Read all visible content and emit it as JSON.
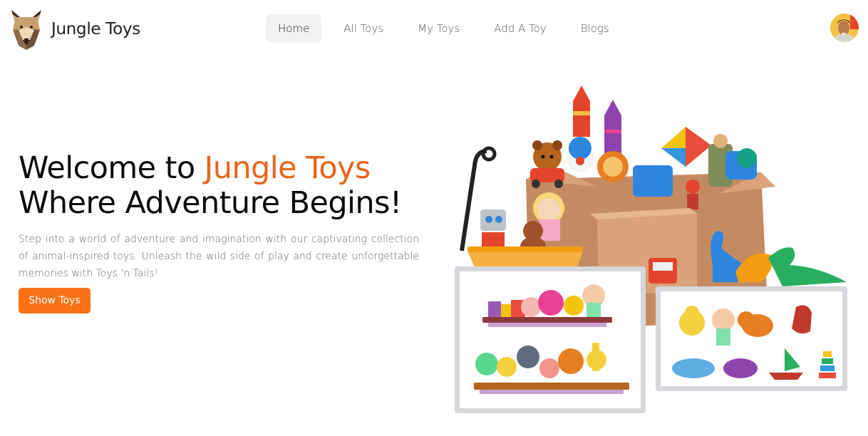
{
  "brand": {
    "name": "Jungle Toys",
    "logo_icon": "bear-face-icon"
  },
  "nav": {
    "items": [
      {
        "label": "Home",
        "active": true
      },
      {
        "label": "All Toys",
        "active": false
      },
      {
        "label": "My Toys",
        "active": false
      },
      {
        "label": "Add A Toy",
        "active": false
      },
      {
        "label": "Blogs",
        "active": false
      }
    ]
  },
  "user": {
    "avatar_icon": "user-avatar-photo"
  },
  "hero": {
    "title_prefix": "Welcome to ",
    "title_accent": "Jungle Toys",
    "title_line2": "Where Adventure Begins!",
    "description": "Step into a world of adventure and imagination with our captivating collection of animal-inspired toys. Unleash the wild side of play and create unforgettable memories with Toys 'n Tails!",
    "button_label": "Show Toys"
  },
  "colors": {
    "accent": "#e8651c",
    "button": "#f97316",
    "nav_active_bg": "#f1f2f4",
    "frame_border": "#d5d7db"
  },
  "illustration": {
    "main_icon": "toy-box-illustration",
    "left_frame_icon": "toy-shelves-illustration",
    "right_frame_icon": "toy-collection-illustration"
  }
}
